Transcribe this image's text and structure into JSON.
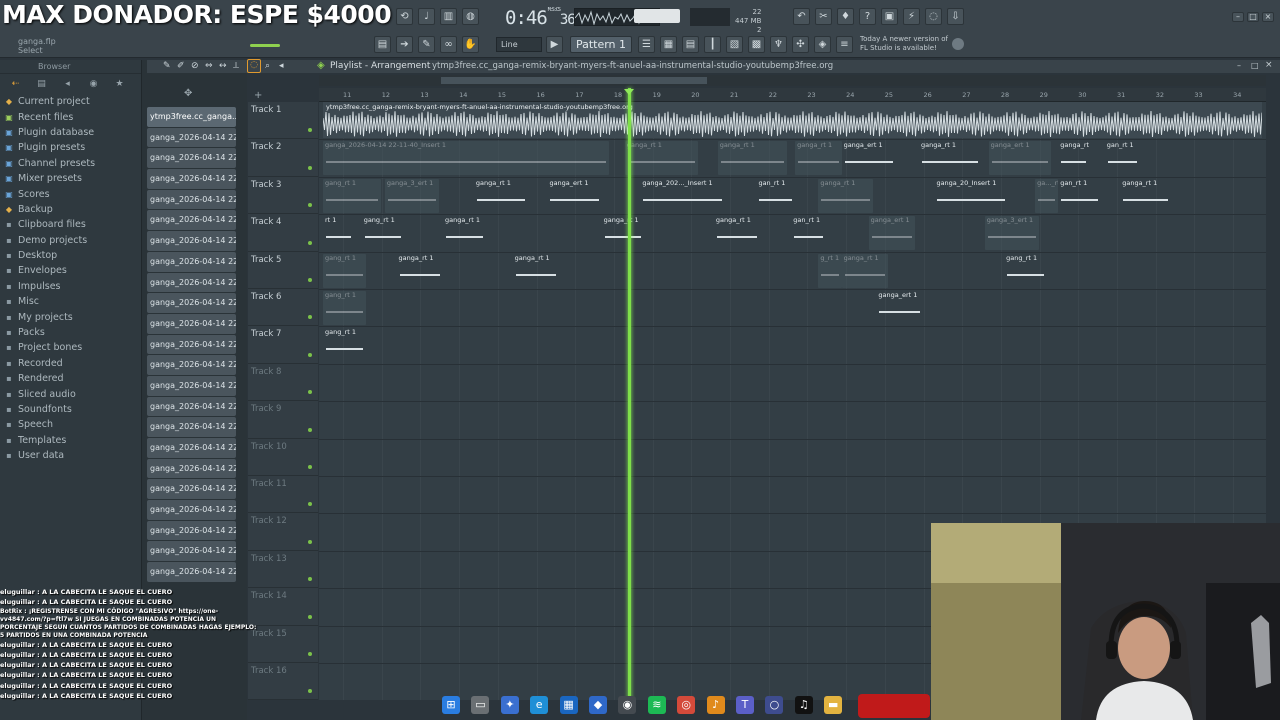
{
  "overlay": {
    "title": "MAX DONADOR: ESPE $4000"
  },
  "toolbar": {
    "hint_file": "ganga.flp",
    "hint_action": "Select",
    "time": "0:46",
    "time_small": "36",
    "time_unit": "M:S:CS",
    "cpu_line1": "22",
    "cpu_line2": "447 MB",
    "cpu_line3": "2",
    "snap": "Line",
    "pattern": "Pattern 1",
    "news_line1": "Today  A newer version of",
    "news_line2": "FL Studio is available!"
  },
  "browser": {
    "label": "Browser",
    "folders": [
      {
        "label": "Current project",
        "icon": "project-icon",
        "tone": "accent"
      },
      {
        "label": "Recent files",
        "icon": "recent-icon",
        "tone": "green"
      },
      {
        "label": "Plugin database",
        "icon": "plugin-db-icon",
        "tone": "blue"
      },
      {
        "label": "Plugin presets",
        "icon": "plugin-preset-icon",
        "tone": "blue"
      },
      {
        "label": "Channel presets",
        "icon": "channel-preset-icon",
        "tone": "blue"
      },
      {
        "label": "Mixer presets",
        "icon": "mixer-preset-icon",
        "tone": "blue"
      },
      {
        "label": "Scores",
        "icon": "score-icon",
        "tone": "blue"
      },
      {
        "label": "Backup",
        "icon": "backup-icon",
        "tone": "accent"
      },
      {
        "label": "Clipboard files",
        "icon": "clipboard-icon",
        "tone": ""
      },
      {
        "label": "Demo projects",
        "icon": "folder-icon",
        "tone": ""
      },
      {
        "label": "Desktop",
        "icon": "folder-icon",
        "tone": ""
      },
      {
        "label": "Envelopes",
        "icon": "folder-icon",
        "tone": ""
      },
      {
        "label": "Impulses",
        "icon": "folder-icon",
        "tone": ""
      },
      {
        "label": "Misc",
        "icon": "folder-icon",
        "tone": ""
      },
      {
        "label": "My projects",
        "icon": "folder-icon",
        "tone": ""
      },
      {
        "label": "Packs",
        "icon": "folder-icon",
        "tone": ""
      },
      {
        "label": "Project bones",
        "icon": "folder-icon",
        "tone": ""
      },
      {
        "label": "Recorded",
        "icon": "folder-icon",
        "tone": ""
      },
      {
        "label": "Rendered",
        "icon": "folder-icon",
        "tone": ""
      },
      {
        "label": "Sliced audio",
        "icon": "folder-icon",
        "tone": ""
      },
      {
        "label": "Soundfonts",
        "icon": "folder-icon",
        "tone": ""
      },
      {
        "label": "Speech",
        "icon": "folder-icon",
        "tone": ""
      },
      {
        "label": "Templates",
        "icon": "folder-icon",
        "tone": ""
      },
      {
        "label": "User data",
        "icon": "folder-icon",
        "tone": ""
      }
    ]
  },
  "clips": {
    "first": "ytmp3free.cc_ganga...",
    "repeat_label": "ganga_2026-04-14 22-1...",
    "items_after_first": 22,
    "repeat_label_2": "ganga_2026-04-14 22-3..."
  },
  "playlist": {
    "title": "Playlist - Arrangement",
    "path": "ytmp3free.cc_ganga-remix-bryant-myers-ft-anuel-aa-instrumental-studio-youtubemp3free.org",
    "track1_clip": "ytmp3free.cc_ganga-remix-bryant-myers-ft-anuel-aa-instrumental-studio-youtubemp3free.org",
    "tracks": [
      "Track 1",
      "Track 2",
      "Track 3",
      "Track 4",
      "Track 5",
      "Track 6",
      "Track 7",
      "Track 8",
      "Track 9",
      "Track 10",
      "Track 11",
      "Track 12",
      "Track 13",
      "Track 14",
      "Track 15",
      "Track 16"
    ],
    "bars": [
      "11",
      "12",
      "13",
      "14",
      "15",
      "16",
      "17",
      "18",
      "19",
      "20",
      "21",
      "22",
      "23",
      "24",
      "25",
      "26",
      "27",
      "28",
      "29",
      "30",
      "31",
      "32",
      "33",
      "34"
    ],
    "clips": [
      {
        "track": 2,
        "start": 0,
        "len": 7.4,
        "label": "ganga_2026-04-14 22-11-40_Insert 1",
        "faded": true
      },
      {
        "track": 2,
        "start": 7.8,
        "len": 1.9,
        "label": "ganga_rt 1",
        "faded": true
      },
      {
        "track": 2,
        "start": 10.2,
        "len": 1.8,
        "label": "ganga_rt 1",
        "faded": true
      },
      {
        "track": 2,
        "start": 12.2,
        "len": 1.2,
        "label": "ganga_rt 1",
        "faded": true
      },
      {
        "track": 2,
        "start": 13.4,
        "len": 1.4,
        "label": "ganga_ert 1",
        "faded": false
      },
      {
        "track": 2,
        "start": 15.4,
        "len": 1.6,
        "label": "ganga_rt 1",
        "faded": false
      },
      {
        "track": 2,
        "start": 17.2,
        "len": 1.6,
        "label": "ganga_ert 1",
        "faded": true
      },
      {
        "track": 2,
        "start": 19.0,
        "len": 0.8,
        "label": "ganga_rt 1",
        "faded": false
      },
      {
        "track": 2,
        "start": 20.2,
        "len": 0.9,
        "label": "gan_rt 1",
        "faded": false
      },
      {
        "track": 3,
        "start": 0,
        "len": 1.5,
        "label": "gang_rt 1",
        "faded": true
      },
      {
        "track": 3,
        "start": 1.6,
        "len": 1.4,
        "label": "ganga_3_ert 1",
        "faded": true
      },
      {
        "track": 3,
        "start": 3.9,
        "len": 1.4,
        "label": "ganga_rt 1",
        "faded": false
      },
      {
        "track": 3,
        "start": 5.8,
        "len": 1.4,
        "label": "ganga_ert 1",
        "faded": false
      },
      {
        "track": 3,
        "start": 8.2,
        "len": 2.2,
        "label": "ganga_202..._Insert 1",
        "faded": false
      },
      {
        "track": 3,
        "start": 11.2,
        "len": 1.0,
        "label": "gan_rt 1",
        "faded": false
      },
      {
        "track": 3,
        "start": 12.8,
        "len": 1.4,
        "label": "ganga_rt 1",
        "faded": true
      },
      {
        "track": 3,
        "start": 15.8,
        "len": 1.9,
        "label": "ganga_20_Insert 1",
        "faded": false
      },
      {
        "track": 3,
        "start": 18.4,
        "len": 0.6,
        "label": "ga..._rt 1",
        "faded": true
      },
      {
        "track": 3,
        "start": 19.0,
        "len": 1.1,
        "label": "gan_rt 1",
        "faded": false
      },
      {
        "track": 3,
        "start": 20.6,
        "len": 1.3,
        "label": "ganga_rt 1",
        "faded": false
      },
      {
        "track": 4,
        "start": 0,
        "len": 0.8,
        "label": "rt 1",
        "faded": false
      },
      {
        "track": 4,
        "start": 1.0,
        "len": 1.1,
        "label": "gang_rt 1",
        "faded": false
      },
      {
        "track": 4,
        "start": 3.1,
        "len": 1.1,
        "label": "ganga_rt 1",
        "faded": false
      },
      {
        "track": 4,
        "start": 7.2,
        "len": 1.1,
        "label": "ganga_rt 1",
        "faded": false
      },
      {
        "track": 4,
        "start": 10.1,
        "len": 1.2,
        "label": "ganga_rt 1",
        "faded": false
      },
      {
        "track": 4,
        "start": 12.1,
        "len": 0.9,
        "label": "gan_rt 1",
        "faded": false
      },
      {
        "track": 4,
        "start": 14.1,
        "len": 1.2,
        "label": "ganga_ert 1",
        "faded": true
      },
      {
        "track": 4,
        "start": 17.1,
        "len": 1.4,
        "label": "ganga_3_ert 1",
        "faded": true
      },
      {
        "track": 5,
        "start": 0,
        "len": 1.1,
        "label": "gang_rt 1",
        "faded": true
      },
      {
        "track": 5,
        "start": 1.9,
        "len": 1.2,
        "label": "ganga_rt 1",
        "faded": false
      },
      {
        "track": 5,
        "start": 4.9,
        "len": 1.2,
        "label": "ganga_rt 1",
        "faded": false
      },
      {
        "track": 5,
        "start": 12.8,
        "len": 0.6,
        "label": "g_rt 1",
        "faded": true
      },
      {
        "track": 5,
        "start": 13.4,
        "len": 1.2,
        "label": "ganga_rt 1",
        "faded": true
      },
      {
        "track": 5,
        "start": 17.6,
        "len": 1.1,
        "label": "gang_rt 1",
        "faded": false
      },
      {
        "track": 6,
        "start": 0,
        "len": 1.1,
        "label": "gang_rt 1",
        "faded": true
      },
      {
        "track": 6,
        "start": 14.3,
        "len": 1.2,
        "label": "ganga_ert 1",
        "faded": false
      },
      {
        "track": 7,
        "start": 0,
        "len": 1.1,
        "label": "gang_rt 1",
        "faded": false
      }
    ]
  },
  "chat": [
    {
      "text": "eluguillar : A LA CABECITA LE SAQUE EL CUERO",
      "bot": false
    },
    {
      "text": "eluguillar : A LA CABECITA LE SAQUE EL CUERO",
      "bot": false
    },
    {
      "text": "BotRix : ¡REGISTRENSE CON MI CÓDIGO \"AGRESIVO\" https://one-vv4847.com/?p=ftl7w SI JUEGAS EN COMBINADAS POTENCIA UN PORCENTAJE SEGUN CUANTOS PARTIDOS DE COMBINADAS HAGAS EJEMPLO: 5 PARTIDOS EN UNA COMBINADA POTENCIA",
      "bot": true
    },
    {
      "text": "eluguillar : A LA CABECITA LE SAQUE EL CUERO",
      "bot": false
    },
    {
      "text": "eluguillar : A LA CABECITA LE SAQUE EL CUERO",
      "bot": false
    },
    {
      "text": "eluguillar : A LA CABECITA LE SAQUE EL CUERO",
      "bot": false
    },
    {
      "text": "eluguillar : A LA CABECITA LE SAQUE EL CUERO",
      "bot": false
    },
    {
      "text": "eluguillar : A LA CABECITA LE SAQUE EL CUERO",
      "bot": false
    },
    {
      "text": "eluguillar : A LA CABECITA LE SAQUE EL CUERO",
      "bot": false
    }
  ],
  "taskbar": [
    {
      "name": "windows-start-icon",
      "color": "#2a7de1",
      "glyph": "⊞"
    },
    {
      "name": "file-icon",
      "color": "#6a6f73",
      "glyph": "▭"
    },
    {
      "name": "app-icon",
      "color": "#3a6fd0",
      "glyph": "✦"
    },
    {
      "name": "edge-browser-icon",
      "color": "#1f8fd6",
      "glyph": "e"
    },
    {
      "name": "store-icon",
      "color": "#1a66c0",
      "glyph": "▦"
    },
    {
      "name": "vpn-icon",
      "color": "#2f68c8",
      "glyph": "◆"
    },
    {
      "name": "obs-icon",
      "color": "#444a50",
      "glyph": "◉"
    },
    {
      "name": "spotify-icon",
      "color": "#1db954",
      "glyph": "≋"
    },
    {
      "name": "chrome-icon",
      "color": "#d44a3a",
      "glyph": "◎"
    },
    {
      "name": "fl-studio-icon",
      "color": "#e08a1c",
      "glyph": "♪"
    },
    {
      "name": "teams-icon",
      "color": "#5b5fc7",
      "glyph": "T"
    },
    {
      "name": "cortana-icon",
      "color": "#3e4c8e",
      "glyph": "○"
    },
    {
      "name": "tiktok-icon",
      "color": "#111111",
      "glyph": "♫"
    },
    {
      "name": "explorer-icon",
      "color": "#e3b340",
      "glyph": "▬"
    }
  ],
  "colors": {
    "playhead": "#7fe04a",
    "clip_color": "#4e6b78",
    "clip_faded": "#46575f"
  }
}
